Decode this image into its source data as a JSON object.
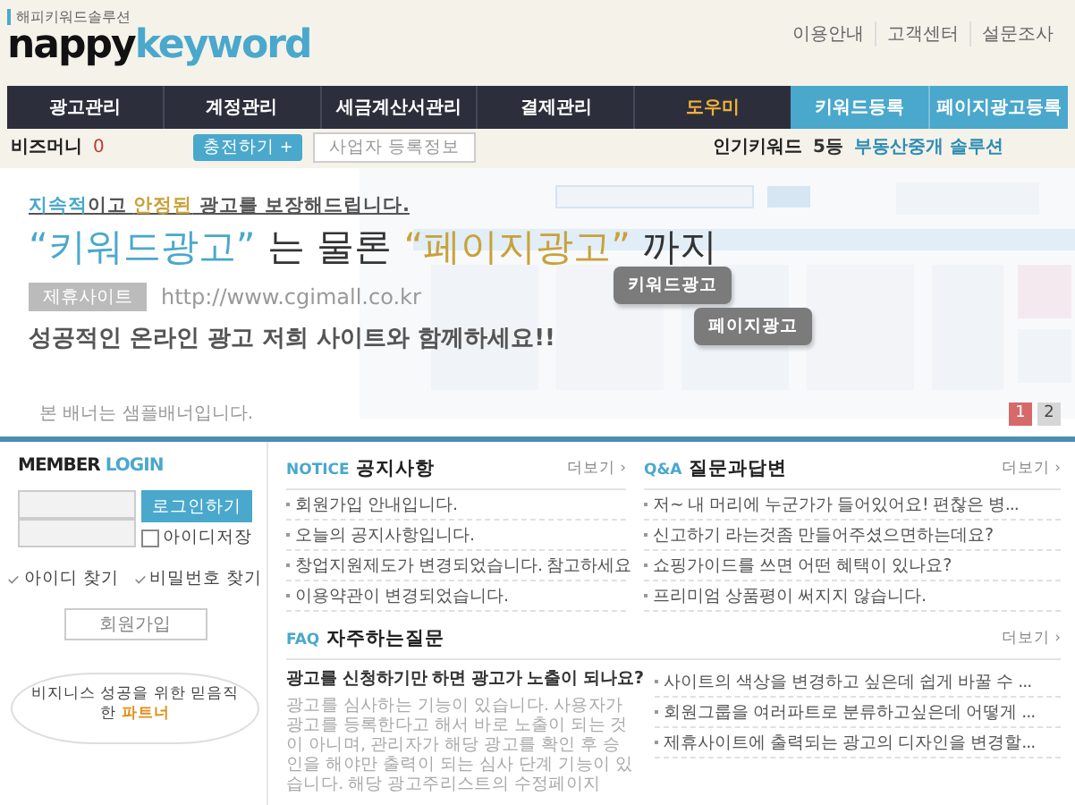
{
  "header": {
    "logo_tagline": "해피키워드솔루션",
    "logo_main": "nappy",
    "logo_accent": "keyword",
    "top_links": [
      "이용안내",
      "고객센터",
      "설문조사"
    ]
  },
  "nav": {
    "items": [
      {
        "label": "광고관리",
        "selected": false
      },
      {
        "label": "계정관리",
        "selected": false
      },
      {
        "label": "세금계산서관리",
        "selected": false
      },
      {
        "label": "결제관리",
        "selected": false
      },
      {
        "label": "도우미",
        "selected": true
      }
    ],
    "actions": [
      "키워드등록",
      "페이지광고등록"
    ]
  },
  "info_bar": {
    "bizmoney_label": "비즈머니",
    "bizmoney_value": "0",
    "charge_button": "충전하기",
    "charge_icon": "+",
    "business_button": "사업자 등록정보",
    "popular_label": "인기키워드",
    "popular_rank": "5등",
    "popular_keyword": "부동산중개 솔루션"
  },
  "banner": {
    "tagline": [
      {
        "text": "지속적",
        "kind": "accent1"
      },
      {
        "text": "이고 ",
        "kind": "plain"
      },
      {
        "text": "안정된",
        "kind": "accent2"
      },
      {
        "text": " 광고를 보장해드립니다.",
        "kind": "plain"
      }
    ],
    "headline": [
      {
        "text": "“키워드광고”",
        "kind": "accent1"
      },
      {
        "text": " 는 물론 ",
        "kind": "plain"
      },
      {
        "text": "“페이지광고”",
        "kind": "accent2"
      },
      {
        "text": " 까지",
        "kind": "plain"
      }
    ],
    "partner_badge": "제휴사이트",
    "url": "http://www.cgimall.co.kr",
    "slogan": "성공적인 온라인 광고 저희 사이트와 함께하세요!!",
    "callouts": [
      "키워드광고",
      "페이지광고"
    ],
    "note": "본 배너는 샘플배너입니다.",
    "pages": [
      {
        "label": "1",
        "selected": true
      },
      {
        "label": "2",
        "selected": false
      }
    ]
  },
  "login": {
    "title": "MEMBER",
    "title_accent": "LOGIN",
    "login_button": "로그인하기",
    "remember": {
      "label": "아이디저장",
      "checked": false
    },
    "links": [
      "아이디 찾기",
      "비밀번호 찾기"
    ],
    "join_button": "회원가입",
    "promo": "비지니스 성공을 위한 믿음직한 ",
    "promo_accent": "파트너"
  },
  "notice": {
    "label": "NOTICE",
    "title": "공지사항",
    "more": "더보기 ›",
    "items": [
      "회원가입 안내입니다.",
      "오늘의 공지사항입니다.",
      "창업지원제도가 변경되었습니다. 참고하세요",
      "이용약관이 변경되었습니다."
    ]
  },
  "qna": {
    "label": "Q&A",
    "title": "질문과답변",
    "more": "더보기 ›",
    "items": [
      "저~ 내 머리에 누군가가 들어있어요! 편찮은 병...",
      "신고하기 라는것좀 만들어주셨으면하는데요?",
      "쇼핑가이드를 쓰면 어떤 혜택이 있나요?",
      "프리미엄 상품평이 써지지 않습니다."
    ]
  },
  "faq": {
    "label": "FAQ",
    "title": "자주하는질문",
    "more": "더보기 ›",
    "question": "광고를 신청하기만 하면 광고가 노출이 되나요?",
    "answer": "광고를 심사하는 기능이 있습니다. 사용자가 광고를 등록한다고 해서 바로 노출이 되는 것이 아니며, 관리자가 해당 광고를 확인 후 승인을 해야만 출력이 되는 심사 단계 기능이 있습니다. 해당 광고주리스트의 수정페이지",
    "items": [
      "사이트의 색상을 변경하고 싶은데 쉽게 바꿀 수 ...",
      "회원그룹을 여러파트로 분류하고싶은데 어떻게 ...",
      "제휴사이트에 출력되는 광고의 디자인을 변경할..."
    ]
  }
}
